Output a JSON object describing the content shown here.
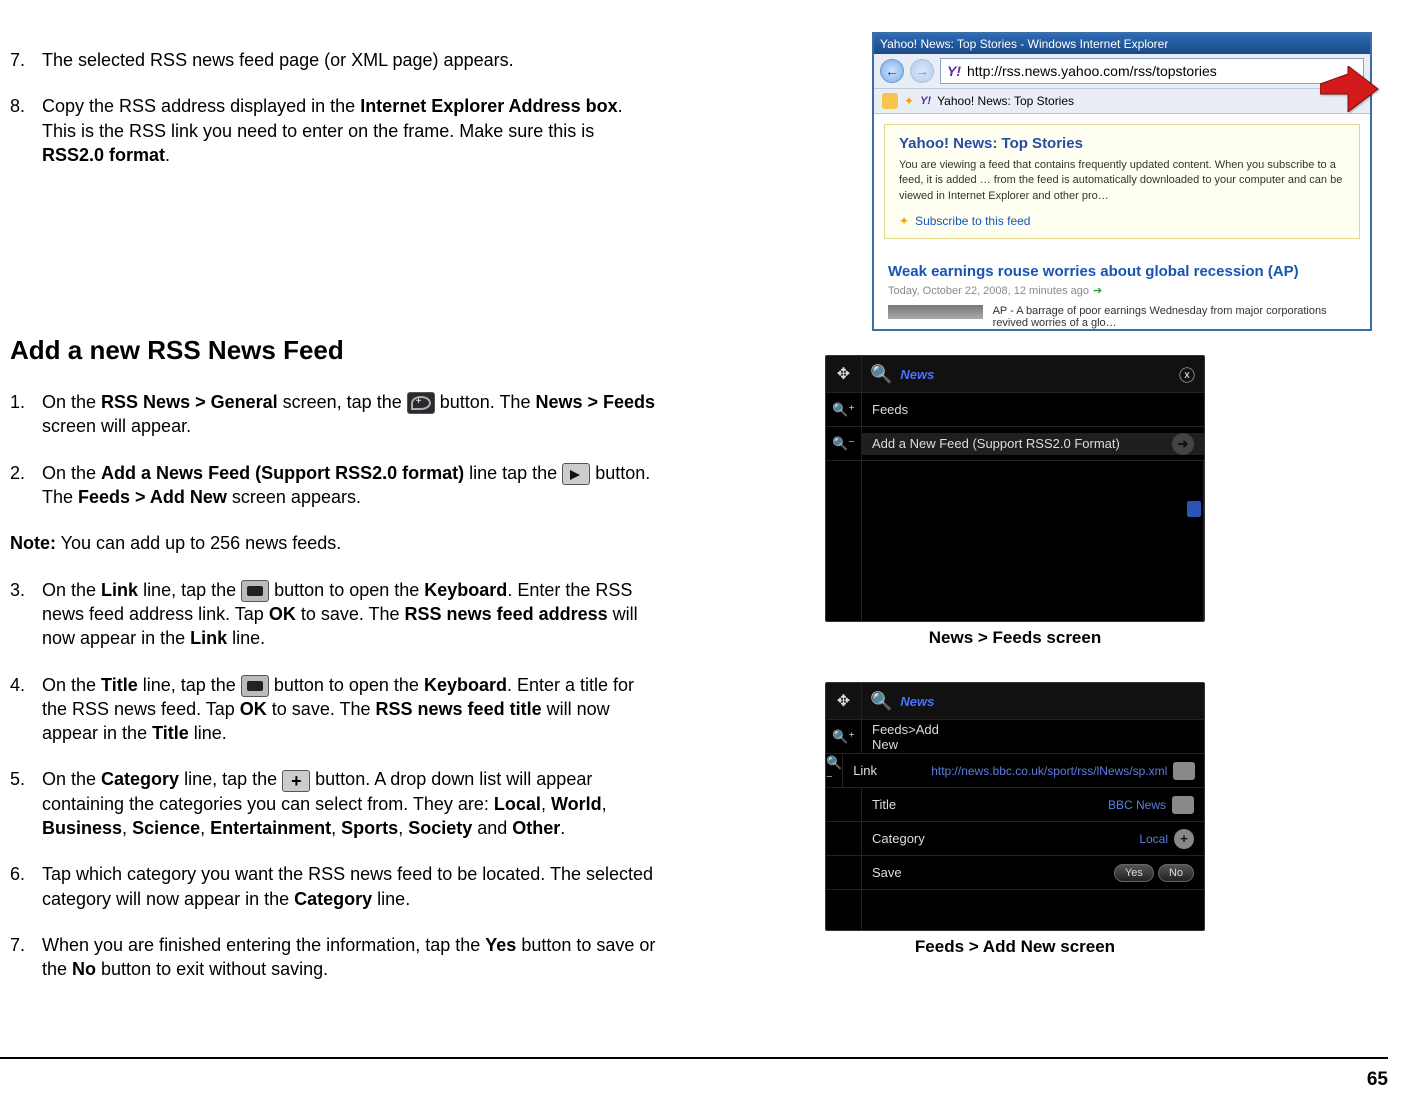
{
  "page_number": "65",
  "steps_top": [
    {
      "n": "7.",
      "text_before": "The selected RSS news feed page (or XML page) appears."
    },
    {
      "n": "8.",
      "text_before": "Copy the RSS address displayed in the ",
      "bold1": "Internet Explorer Address box",
      "after1": ". This is the RSS link you need to enter on the frame.  Make sure this is ",
      "bold2": "RSS2.0 format",
      "after2": "."
    }
  ],
  "section_heading": "Add a new RSS News Feed",
  "steps_main": {
    "1": {
      "n": "1.",
      "a": "On the ",
      "b1": "RSS News > General",
      "c": " screen, tap the ",
      "d": " button.  The ",
      "b2": "News > Feeds",
      "e": " screen will appear."
    },
    "2": {
      "n": "2.",
      "a": "On the ",
      "b1": "Add a News Feed (Support RSS2.0 format)",
      "c": " line tap the ",
      "d": " button.  The ",
      "b2": "Feeds > Add New",
      "e": " screen appears."
    },
    "note_label": "Note:",
    "note_text": " You can add up to 256 news feeds.",
    "3": {
      "n": "3.",
      "a": "On the ",
      "b1": "Link",
      "c": " line, tap the ",
      "d": " button to open the ",
      "b2": "Keyboard",
      "e": ".  Enter the RSS news feed address link.  Tap ",
      "b3": "OK",
      "f": " to save.  The ",
      "b4": "RSS news feed address",
      "g": " will now appear in the ",
      "b5": "Link",
      "h": " line."
    },
    "4": {
      "n": "4.",
      "a": "On the ",
      "b1": "Title",
      "c": " line, tap the ",
      "d": " button to open the ",
      "b2": "Keyboard",
      "e": ".  Enter a title for the RSS news feed.  Tap ",
      "b3": "OK",
      "f": " to save.  The ",
      "b4": "RSS news feed title",
      "g": " will now appear in the ",
      "b5": "Title",
      "h": " line."
    },
    "5": {
      "n": "5.",
      "a": "On the ",
      "b1": "Category",
      "c": " line, tap the ",
      "d": " button.  A drop down list will appear containing the categories you can select from.  They are:  ",
      "cats": [
        "Local",
        "World",
        "Business",
        "Science",
        "Entertainment",
        "Sports",
        "Society",
        "Other"
      ]
    },
    "6": {
      "n": "6.",
      "a": "Tap which category you want the RSS news feed to be located.  The selected category will now appear in the ",
      "b1": "Category",
      "c": " line."
    },
    "7": {
      "n": "7.",
      "a": "When you are finished entering the information, tap the ",
      "b1": "Yes",
      "c": " button to save or the ",
      "b2": "No",
      "d": " button to exit without saving."
    }
  },
  "ie": {
    "title": "Yahoo! News: Top Stories - Windows Internet Explorer",
    "url": "http://rss.news.yahoo.com/rss/topstories",
    "tab": "Yahoo! News: Top Stories",
    "box_h": "Yahoo! News: Top Stories",
    "box_p": "You are viewing a feed that contains frequently updated content. When you subscribe to a feed, it is added … from the feed is automatically downloaded to your computer and can be viewed in Internet Explorer and other pro…",
    "subscribe": "Subscribe to this feed",
    "headline": "Weak earnings rouse worries about global recession (AP)",
    "ts": "Today, October 22, 2008, 12 minutes ago",
    "article": "AP - A barrage of poor earnings Wednesday from major corporations revived worries of a glo…"
  },
  "dev1": {
    "title": "News",
    "breadcrumb": "Feeds",
    "row1": "Add a New Feed (Support RSS2.0 Format)",
    "caption": "News > Feeds screen"
  },
  "dev2": {
    "title": "News",
    "breadcrumb": "Feeds>Add New",
    "rows": {
      "link_label": "Link",
      "link_value": "http://news.bbc.co.uk/sport/rss/lNews/sp.xml",
      "title_label": "Title",
      "title_value": "BBC News",
      "cat_label": "Category",
      "cat_value": "Local",
      "save_label": "Save",
      "yes": "Yes",
      "no": "No"
    },
    "caption": "Feeds > Add New screen"
  }
}
